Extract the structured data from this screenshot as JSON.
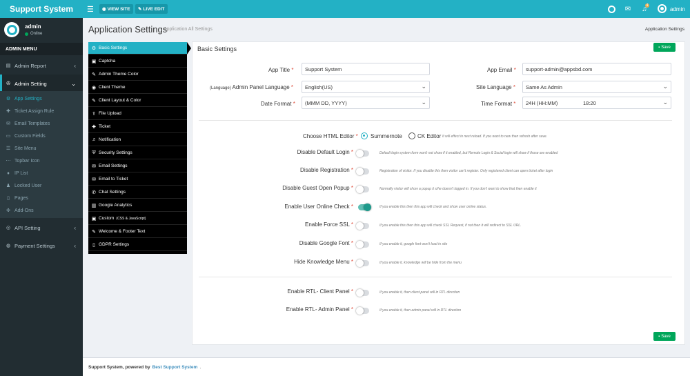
{
  "app": {
    "brand": "Support System"
  },
  "topbar": {
    "view_site": "VIEW SITE",
    "live_edit": "LIVE EDIT",
    "notif_count": "4",
    "user": "admin"
  },
  "sidebar": {
    "user_name": "admin",
    "user_status": "Online",
    "menu_header": "ADMIN MENU",
    "items": [
      {
        "label": "Admin Report"
      },
      {
        "label": "Admin Setting"
      },
      {
        "label": "API Setting"
      },
      {
        "label": "Payment Settings"
      }
    ],
    "subitems": [
      {
        "label": "App Settings"
      },
      {
        "label": "Ticket Assign Rule"
      },
      {
        "label": "Email Templates"
      },
      {
        "label": "Custom Fields"
      },
      {
        "label": "Site Menu"
      },
      {
        "label": "Topbar Icon"
      },
      {
        "label": "IP List"
      },
      {
        "label": "Locked User"
      },
      {
        "label": "Pages"
      },
      {
        "label": "Add-Ons"
      }
    ]
  },
  "header": {
    "title": "Application Settings",
    "subtitle": "Application All Settings",
    "breadcrumb": "Application Settings"
  },
  "tabs": [
    {
      "label": "Basic Settings"
    },
    {
      "label": "Captcha"
    },
    {
      "label": "Admin Theme Color"
    },
    {
      "label": "Client Theme"
    },
    {
      "label": "Client Layout & Color"
    },
    {
      "label": "File Upload"
    },
    {
      "label": "Ticket"
    },
    {
      "label": "Notification"
    },
    {
      "label": "Security Settings"
    },
    {
      "label": "Email Settings"
    },
    {
      "label": "Email to Ticket"
    },
    {
      "label": "Chat Settings"
    },
    {
      "label": "Google Analytics"
    },
    {
      "label": "Custom",
      "small": "(CSS & JavaScript)"
    },
    {
      "label": "Welcome & Footer Text"
    },
    {
      "label": "GDPR Settings"
    }
  ],
  "panel": {
    "title": "Basic Settings",
    "save_label": "Save"
  },
  "form": {
    "app_title_label": "App Title",
    "app_title_value": "Support System",
    "app_email_label": "App Email",
    "app_email_value": "support-admin@appsbd.com",
    "panel_lang_label_small": "(Language)",
    "panel_lang_label": "Admin Panel Language",
    "panel_lang_value": "English(US)",
    "site_lang_label": "Site Language",
    "site_lang_value": "Same As Admin",
    "date_format_label": "Date Format",
    "date_format_value": "(MMM DD, YYYY)",
    "time_format_label": "Time Format",
    "time_format_value": "24H (HH:MM)",
    "time_format_example": "18:20",
    "editor_label": "Choose HTML Editor",
    "editor_opt1": "Summernote",
    "editor_opt2": "CK Editor",
    "editor_hint": "It will effect in next reload. If you want to new then refresh after save."
  },
  "toggles": [
    {
      "label": "Disable Default Login",
      "on": false,
      "hint": "Default login system form won't not show if it enabled, but Remote Login & Social login will show if those are enabled"
    },
    {
      "label": "Disable Registration",
      "on": false,
      "hint": "Registration of visitor. If you disable this then visitor can't register. Only registered client can open ticket after login"
    },
    {
      "label": "Disable Guest Open Popup",
      "on": false,
      "hint": "Normally visitor will show a popup it s/he doesn't logged in. If you don't want to show that then enable it"
    },
    {
      "label": "Enable User Online Check",
      "on": true,
      "hint": "If you enable this then this app will check and show user online status."
    },
    {
      "label": "Enable Force SSL",
      "on": false,
      "hint": "If you enable this then this app will check SSL Request, if not then it will redirect to SSL URL."
    },
    {
      "label": "Disable Google Font",
      "on": false,
      "hint": "If you enable it, google font won't load in site"
    },
    {
      "label": "Hide Knowledge Menu",
      "on": false,
      "hint": "If you enable it, knowledge will be hide from the menu"
    },
    {
      "label": "Enable RTL- Client Panel",
      "on": false,
      "hint": "If you enable it, then client panel will in RTL direction"
    },
    {
      "label": "Enable RTL- Admin Panel",
      "on": false,
      "hint": "If you enable it, then admin panel will in RTL direction"
    }
  ],
  "footer": {
    "text": "Support System, powered by",
    "link": "Best Support System",
    "dot": "."
  },
  "colors": {
    "accent": "#23b1c5",
    "sidebar": "#222d32",
    "success": "#00a65a"
  }
}
